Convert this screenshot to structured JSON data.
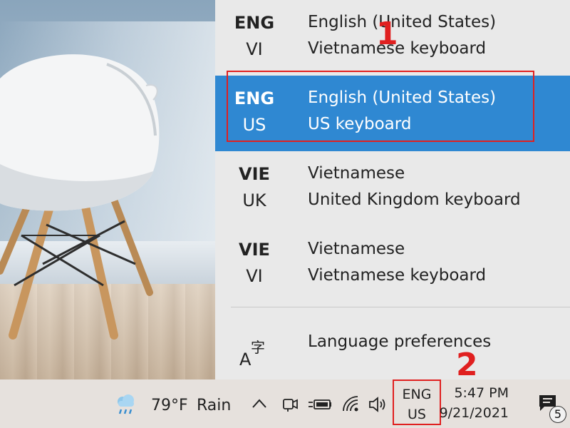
{
  "language_flyout": {
    "items": [
      {
        "code": "ENG",
        "layout_code": "VI",
        "language": "English (United States)",
        "keyboard": "Vietnamese keyboard",
        "selected": false
      },
      {
        "code": "ENG",
        "layout_code": "US",
        "language": "English (United States)",
        "keyboard": "US keyboard",
        "selected": true
      },
      {
        "code": "VIE",
        "layout_code": "UK",
        "language": "Vietnamese",
        "keyboard": "United Kingdom keyboard",
        "selected": false
      },
      {
        "code": "VIE",
        "layout_code": "VI",
        "language": "Vietnamese",
        "keyboard": "Vietnamese keyboard",
        "selected": false
      }
    ],
    "preferences_label": "Language preferences",
    "preferences_icon": "language-icon"
  },
  "annotations": {
    "step_1": "1",
    "step_2": "2"
  },
  "taskbar": {
    "weather": {
      "temperature": "79°F",
      "condition": "Rain",
      "icon": "weather-rain-icon"
    },
    "tray_icons": [
      "chevron-up-icon",
      "meet-now-icon",
      "power-plug-icon",
      "battery-icon",
      "wifi-icon",
      "speaker-icon"
    ],
    "language_indicator": {
      "line1": "ENG",
      "line2": "US"
    },
    "clock": {
      "time": "5:47 PM",
      "date": "9/21/2021"
    },
    "notifications": {
      "icon": "notification-icon",
      "count": "5"
    }
  },
  "colors": {
    "selected_item": "#2f88d2",
    "annotation_red": "#e02020",
    "flyout_bg": "#e9e9e9",
    "taskbar_bg": "#e6e1dd"
  }
}
